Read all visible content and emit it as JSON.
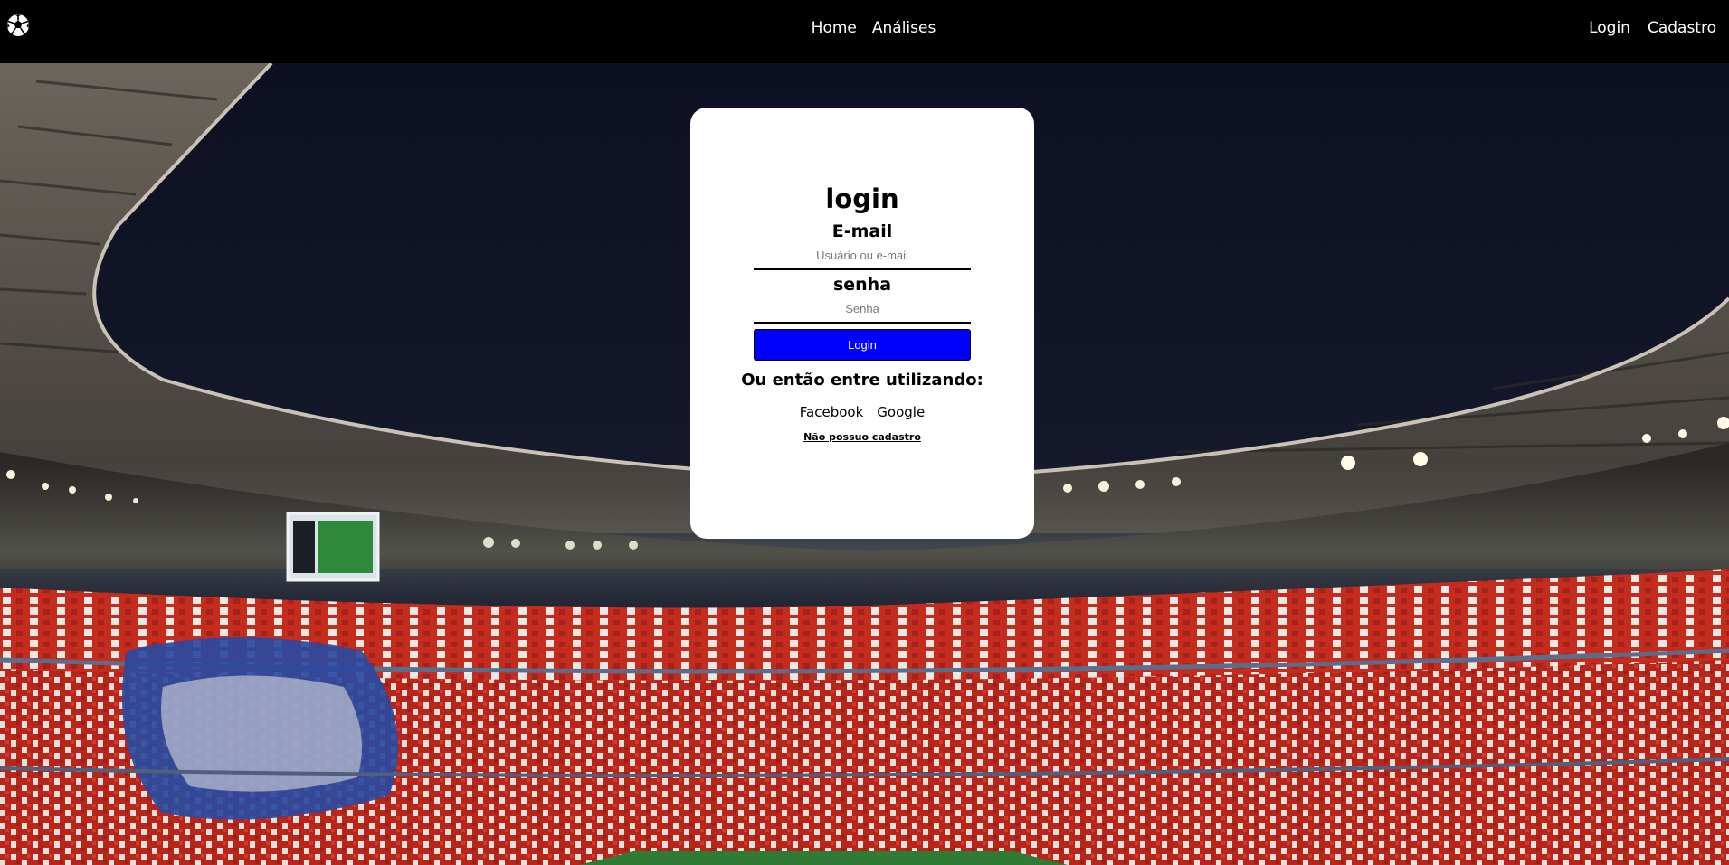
{
  "navbar": {
    "logo_icon": "soccer-ball-icon",
    "center_links": [
      {
        "label": "Home"
      },
      {
        "label": "Análises"
      }
    ],
    "right_links": [
      {
        "label": "Login"
      },
      {
        "label": "Cadastro"
      }
    ]
  },
  "background": {
    "description_icon": "stadium-background",
    "colors": {
      "sky": "#12172a",
      "roof": "#5b554f",
      "stand_red": "#c8291c",
      "stand_white": "#e8e6e2",
      "crest_blue": "#2a4aa0",
      "pitch": "#2f7a35"
    }
  },
  "login_card": {
    "title": "login",
    "email_label": "E-mail",
    "email_placeholder": "Usuário ou e-mail",
    "email_value": "",
    "password_label": "senha",
    "password_placeholder": "Senha",
    "password_value": "",
    "submit_label": "Login",
    "alt_text": "Ou então entre utilizando:",
    "social": [
      {
        "label": "Facebook"
      },
      {
        "label": "Google"
      }
    ],
    "signup_link": "Não possuo cadastro",
    "colors": {
      "card_bg": "#ffffff",
      "button_bg": "#0000ff",
      "button_text": "#ffffff"
    }
  }
}
